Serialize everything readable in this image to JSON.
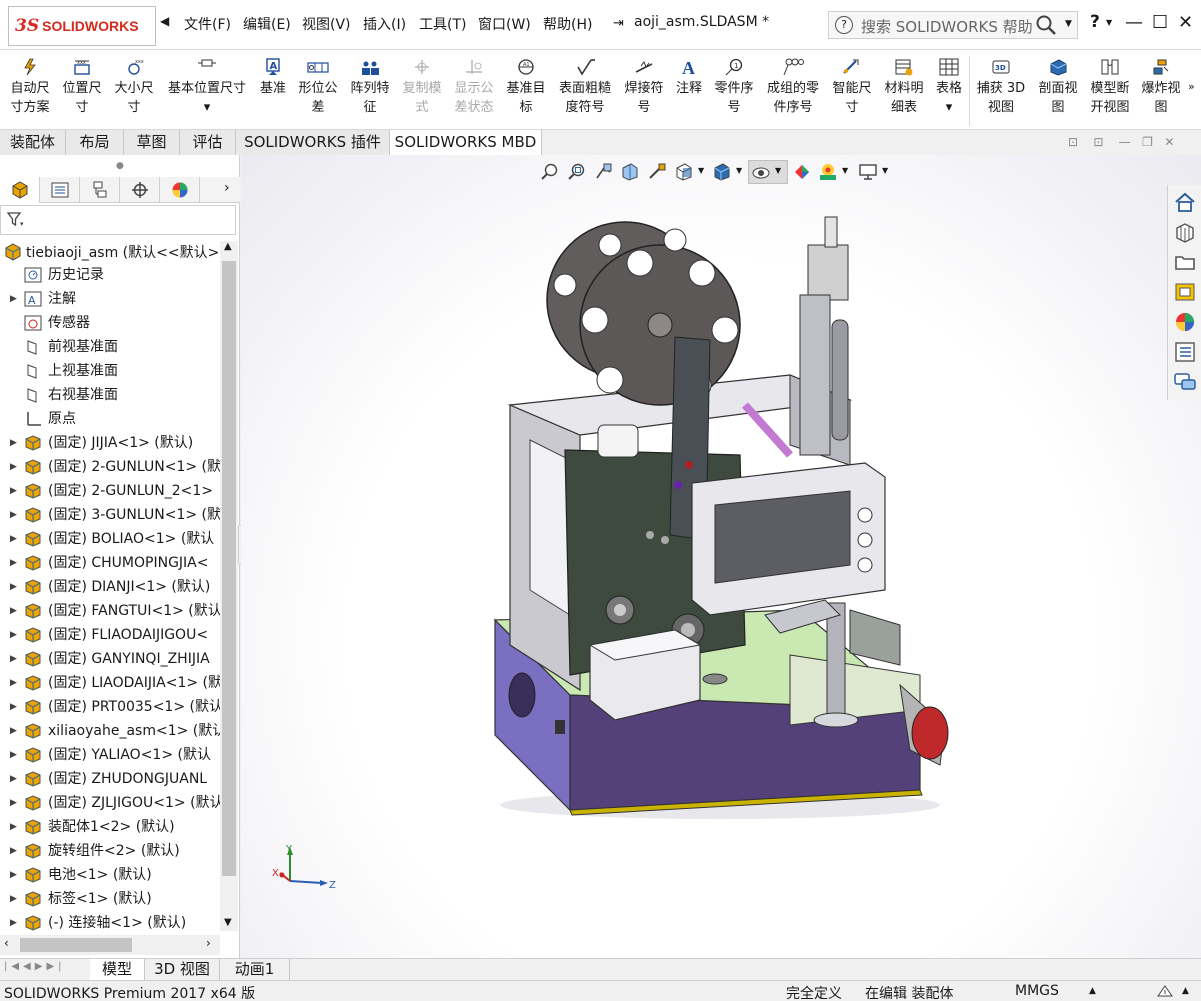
{
  "app": {
    "brand_mark": "3S",
    "brand_name": "SOLIDWORKS",
    "document_title": "aoji_asm.SLDASM *"
  },
  "menu": {
    "items": [
      "文件(F)",
      "编辑(E)",
      "视图(V)",
      "插入(I)",
      "工具(T)",
      "窗口(W)",
      "帮助(H)"
    ]
  },
  "search": {
    "placeholder": "搜索 SOLIDWORKS 帮助"
  },
  "window_buttons": {
    "help": "?",
    "minimize": "—",
    "restore": "☐",
    "close": "✕"
  },
  "toolbar": {
    "buttons": [
      {
        "label1": "自动尺",
        "label2": "寸方案",
        "enabled": true
      },
      {
        "label1": "位置尺",
        "label2": "寸",
        "enabled": true
      },
      {
        "label1": "大小尺",
        "label2": "寸",
        "enabled": true
      },
      {
        "label1": "基本位置尺寸",
        "label2": "▾",
        "enabled": true
      },
      {
        "label1": "基准",
        "label2": "",
        "enabled": true
      },
      {
        "label1": "形位公",
        "label2": "差",
        "enabled": true
      },
      {
        "label1": "阵列特",
        "label2": "征",
        "enabled": true
      },
      {
        "label1": "复制模",
        "label2": "式",
        "enabled": false
      },
      {
        "label1": "显示公",
        "label2": "差状态",
        "enabled": false
      },
      {
        "label1": "基准目",
        "label2": "标",
        "enabled": true
      },
      {
        "label1": "表面粗糙",
        "label2": "度符号",
        "enabled": true
      },
      {
        "label1": "焊接符",
        "label2": "号",
        "enabled": true
      },
      {
        "label1": "注释",
        "label2": "",
        "enabled": true
      },
      {
        "label1": "零件序",
        "label2": "号",
        "enabled": true
      },
      {
        "label1": "成组的零",
        "label2": "件序号",
        "enabled": true
      },
      {
        "label1": "智能尺",
        "label2": "寸",
        "enabled": true
      },
      {
        "label1": "材料明",
        "label2": "细表",
        "enabled": true
      },
      {
        "label1": "表格",
        "label2": "▾",
        "enabled": true
      },
      {
        "label1": "捕获 3D",
        "label2": "视图",
        "enabled": true
      },
      {
        "label1": "剖面视",
        "label2": "图",
        "enabled": true
      },
      {
        "label1": "模型断",
        "label2": "开视图",
        "enabled": true
      },
      {
        "label1": "爆炸视",
        "label2": "图",
        "enabled": true
      }
    ]
  },
  "command_tabs": [
    "装配体",
    "布局",
    "草图",
    "评估",
    "SOLIDWORKS 插件",
    "SOLIDWORKS MBD"
  ],
  "feature_tree": {
    "root": "tiebiaoji_asm (默认<<默认>",
    "items": [
      {
        "label": "历史记录",
        "expandable": false
      },
      {
        "label": "注解",
        "expandable": true
      },
      {
        "label": "传感器",
        "expandable": false
      },
      {
        "label": "前视基准面",
        "expandable": false
      },
      {
        "label": "上视基准面",
        "expandable": false
      },
      {
        "label": "右视基准面",
        "expandable": false
      },
      {
        "label": "原点",
        "expandable": false
      },
      {
        "label": "(固定) JIJIA<1> (默认)",
        "expandable": true
      },
      {
        "label": "(固定) 2-GUNLUN<1> (默",
        "expandable": true
      },
      {
        "label": "(固定) 2-GUNLUN_2<1>",
        "expandable": true
      },
      {
        "label": "(固定) 3-GUNLUN<1> (默",
        "expandable": true
      },
      {
        "label": "(固定) BOLIAO<1> (默认",
        "expandable": true
      },
      {
        "label": "(固定) CHUMOPINGJIA<",
        "expandable": true
      },
      {
        "label": "(固定) DIANJI<1> (默认)",
        "expandable": true
      },
      {
        "label": "(固定) FANGTUI<1> (默认",
        "expandable": true
      },
      {
        "label": "(固定) FLIAODAIJIGOU<",
        "expandable": true
      },
      {
        "label": "(固定) GANYINQI_ZHIJIA",
        "expandable": true
      },
      {
        "label": "(固定) LIAODAIJIA<1> (默",
        "expandable": true
      },
      {
        "label": "(固定) PRT0035<1> (默认",
        "expandable": true
      },
      {
        "label": "xiliaoyahe_asm<1> (默认",
        "expandable": true
      },
      {
        "label": "(固定) YALIAO<1> (默认",
        "expandable": true
      },
      {
        "label": "(固定) ZHUDONGJUANL",
        "expandable": true
      },
      {
        "label": "(固定) ZJLJIGOU<1> (默认",
        "expandable": true
      },
      {
        "label": "装配体1<2> (默认)",
        "expandable": true
      },
      {
        "label": "旋转组件<2> (默认)",
        "expandable": true
      },
      {
        "label": "电池<1> (默认)",
        "expandable": true
      },
      {
        "label": "标签<1> (默认)",
        "expandable": true
      },
      {
        "label": "(-) 连接轴<1> (默认)",
        "expandable": true
      }
    ]
  },
  "bottom_tabs": [
    "模型",
    "3D 视图",
    "动画1"
  ],
  "triad": {
    "x": "X",
    "y": "Y",
    "z": "Z"
  },
  "status": {
    "product": "SOLIDWORKS Premium 2017 x64 版",
    "definition": "完全定义",
    "mode": "在编辑 装配体",
    "units": "MMGS"
  },
  "colors": {
    "brand_red": "#d52b1e",
    "housing_purple": "#7a6fc0",
    "plate_green": "#3e4a3e",
    "reel_grey": "#5d5858"
  }
}
